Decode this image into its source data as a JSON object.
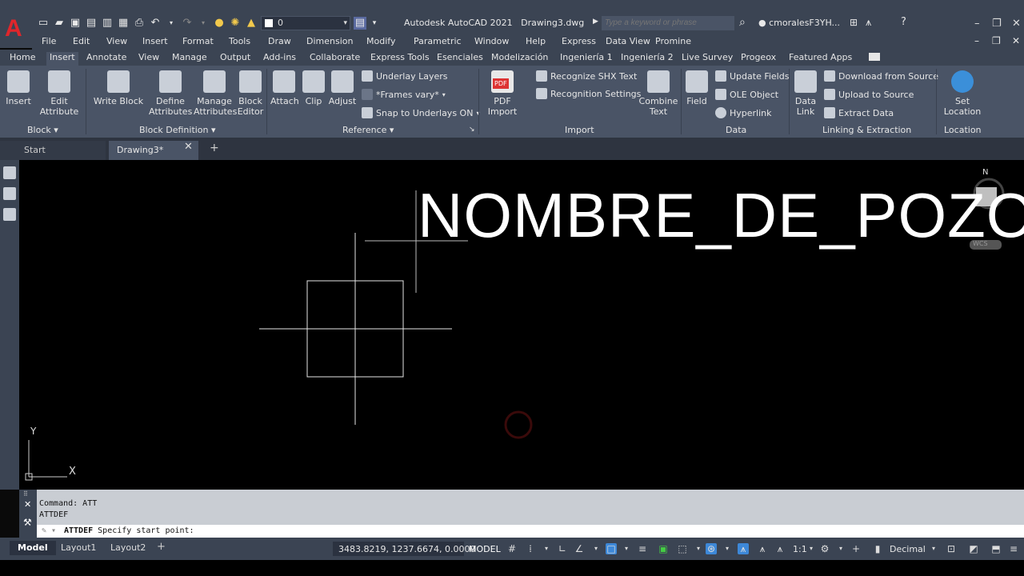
{
  "app": {
    "title": "Autodesk AutoCAD 2021",
    "file": "Drawing3.dwg",
    "logo": "A",
    "layer": "0",
    "search_placeholder": "Type a keyword or phrase",
    "user": "cmoralesF3YH..."
  },
  "menu": [
    "File",
    "Edit",
    "View",
    "Insert",
    "Format",
    "Tools",
    "Draw",
    "Dimension",
    "Modify",
    "Parametric",
    "Window",
    "Help",
    "Express",
    "Data View",
    "Promine"
  ],
  "ribbon_tabs": [
    "Home",
    "Insert",
    "Annotate",
    "View",
    "Manage",
    "Output",
    "Add-ins",
    "Collaborate",
    "Express Tools",
    "Esenciales",
    "Modelización",
    "Ingeniería 1",
    "Ingeniería 2",
    "Live Survey",
    "Progeox",
    "Featured Apps"
  ],
  "ribbon": {
    "insert": "Insert",
    "edit_attribute_1": "Edit",
    "edit_attribute_2": "Attribute",
    "write_block": "Write Block",
    "define_attr_1": "Define",
    "define_attr_2": "Attributes",
    "manage_attr_1": "Manage",
    "manage_attr_2": "Attributes",
    "block_editor_1": "Block",
    "block_editor_2": "Editor",
    "attach": "Attach",
    "clip": "Clip",
    "adjust": "Adjust",
    "underlay_layers": "Underlay Layers",
    "frames_vary": "*Frames vary*",
    "snap_underlays": "Snap to Underlays ON",
    "pdf_import_1": "PDF",
    "pdf_import_2": "Import",
    "recognize_shx": "Recognize SHX Text",
    "recognition_settings": "Recognition Settings",
    "combine_text_1": "Combine",
    "combine_text_2": "Text",
    "field": "Field",
    "update_fields": "Update Fields",
    "ole_object": "OLE Object",
    "hyperlink": "Hyperlink",
    "data_link_1": "Data",
    "data_link_2": "Link",
    "download_source": "Download from Source",
    "upload_source": "Upload to Source",
    "extract_data": "Extract  Data",
    "set_location_1": "Set",
    "set_location_2": "Location",
    "panel_block": "Block",
    "panel_block_definition": "Block Definition",
    "panel_reference": "Reference",
    "panel_import": "Import",
    "panel_data": "Data",
    "panel_linking": "Linking & Extraction",
    "panel_location": "Location",
    "pdf_badge": "PDF"
  },
  "file_tabs": {
    "start": "Start",
    "drawing": "Drawing3*"
  },
  "canvas": {
    "attribute_text": "NOMBRE_DE_POZO",
    "compass_n": "N",
    "wcs": "WCS",
    "ucs_x": "X",
    "ucs_y": "Y"
  },
  "command": {
    "line1": "Command: ATT",
    "line2": "ATTDEF",
    "prompt_cmd": "ATTDEF",
    "prompt_text": "Specify start point:"
  },
  "status": {
    "layouts": [
      "Model",
      "Layout1",
      "Layout2"
    ],
    "coords": "3483.8219, 1237.6674, 0.0000",
    "space": "MODEL",
    "scale": "1:1",
    "units": "Decimal"
  },
  "colors": {
    "accent": "#3d88d8",
    "logo_red": "#e0262b",
    "ribbon_bg": "#4a5466",
    "titlebar_bg": "#3b4453"
  }
}
